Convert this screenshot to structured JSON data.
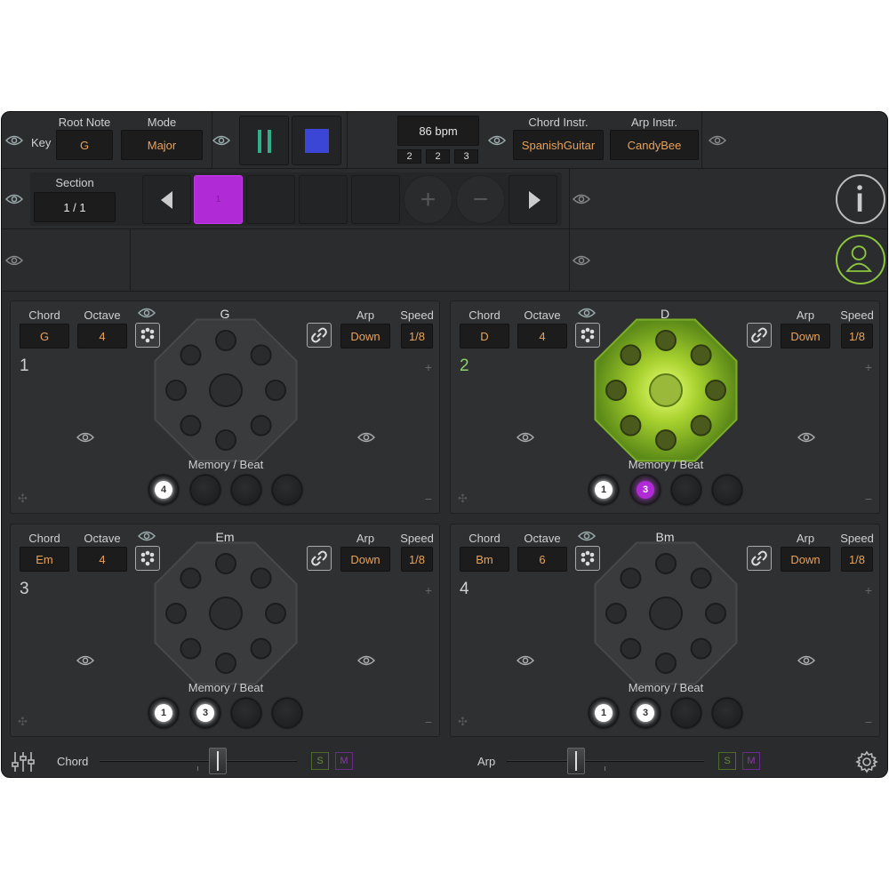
{
  "top": {
    "key_label": "Key",
    "root_note": {
      "label": "Root Note",
      "value": "G"
    },
    "mode": {
      "label": "Mode",
      "value": "Major"
    },
    "bpm": {
      "value": "86 bpm",
      "sub": [
        "2",
        "2",
        "3"
      ]
    },
    "chord_instr": {
      "label": "Chord Instr.",
      "value": "SpanishGuitar"
    },
    "arp_instr": {
      "label": "Arp Instr.",
      "value": "CandyBee"
    }
  },
  "section": {
    "label": "Section",
    "value": "1 / 1",
    "active_cell": "1"
  },
  "sequencer": {
    "plus": "+",
    "minus": "−"
  },
  "panels": [
    {
      "number": "1",
      "title": "G",
      "chord_label": "Chord",
      "chord": "G",
      "octave_label": "Octave",
      "octave": "4",
      "arp_label": "Arp",
      "arp": "Down",
      "speed_label": "Speed",
      "speed": "1/8",
      "memory_label": "Memory / Beat",
      "memory": [
        "4",
        "",
        "",
        ""
      ],
      "active": false
    },
    {
      "number": "2",
      "title": "D",
      "chord_label": "Chord",
      "chord": "D",
      "octave_label": "Octave",
      "octave": "4",
      "arp_label": "Arp",
      "arp": "Down",
      "speed_label": "Speed",
      "speed": "1/8",
      "memory_label": "Memory / Beat",
      "memory": [
        "1",
        "3",
        "",
        ""
      ],
      "active": true
    },
    {
      "number": "3",
      "title": "Em",
      "chord_label": "Chord",
      "chord": "Em",
      "octave_label": "Octave",
      "octave": "4",
      "arp_label": "Arp",
      "arp": "Down",
      "speed_label": "Speed",
      "speed": "1/8",
      "memory_label": "Memory / Beat",
      "memory": [
        "1",
        "3",
        "",
        ""
      ],
      "active": false
    },
    {
      "number": "4",
      "title": "Bm",
      "chord_label": "Chord",
      "chord": "Bm",
      "octave_label": "Octave",
      "octave": "6",
      "arp_label": "Arp",
      "arp": "Down",
      "speed_label": "Speed",
      "speed": "1/8",
      "memory_label": "Memory / Beat",
      "memory": [
        "1",
        "3",
        "",
        ""
      ],
      "active": false
    }
  ],
  "mixer": {
    "chord_label": "Chord",
    "chord_level": 0.6,
    "arp_label": "Arp",
    "arp_level": 0.35,
    "solo": "S",
    "mute": "M"
  },
  "colors": {
    "accent_orange": "#e8a25a",
    "active_purple": "#b02bd6",
    "active_green": "#8fd16a",
    "stop_blue": "#3b45d6",
    "play_teal": "#2fb08a"
  }
}
